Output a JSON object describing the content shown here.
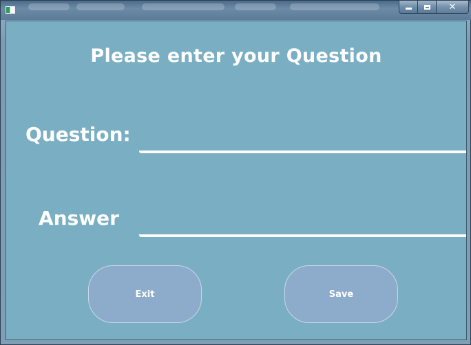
{
  "window": {
    "controls": {
      "minimize": "minimize-icon",
      "maximize": "maximize-icon",
      "close": "close-icon"
    }
  },
  "form": {
    "heading": "Please enter your Question",
    "question_label": "Question:",
    "question_value": "",
    "answer_label": "Answer",
    "answer_value": ""
  },
  "buttons": {
    "exit_label": "Exit",
    "save_label": "Save"
  },
  "colors": {
    "background": "#7aafc3",
    "button": "#8daccb",
    "text": "#ffffff"
  }
}
